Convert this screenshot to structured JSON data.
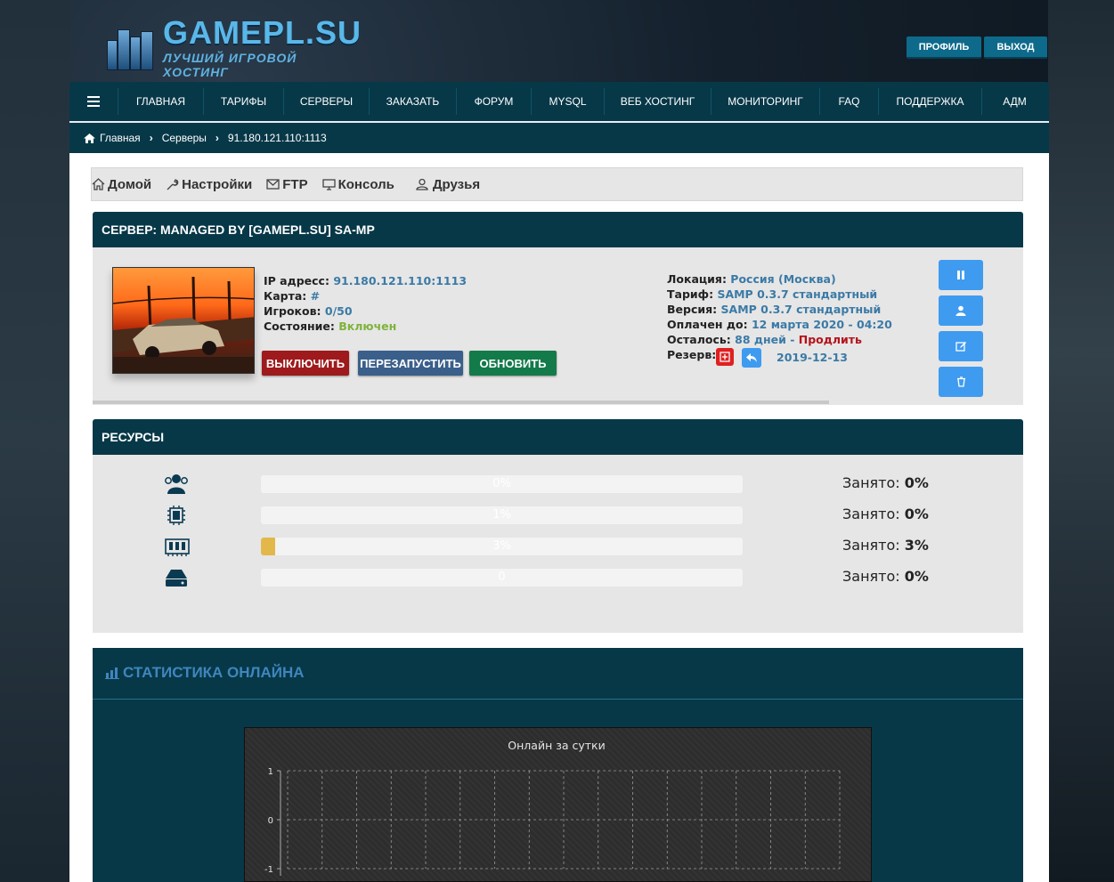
{
  "header": {
    "logo_title": "GAMEPL.SU",
    "logo_subtitle": "ЛУЧШИЙ ИГРОВОЙ ХОСТИНГ",
    "profile_button": "ПРОФИЛЬ",
    "logout_button": "ВЫХОД"
  },
  "nav": {
    "items": [
      "ГЛАВНАЯ",
      "ТАРИФЫ",
      "СЕРВЕРЫ",
      "ЗАКАЗАТЬ",
      "ФОРУМ",
      "MYSQL",
      "ВЕБ ХОСТИНГ",
      "МОНИТОРИНГ",
      "FAQ",
      "ПОДДЕРЖКА",
      "АДМ"
    ]
  },
  "breadcrumb": {
    "home": "Главная",
    "servers": "Серверы",
    "current": "91.180.121.110:1113"
  },
  "tabs": [
    "Домой",
    "Настройки",
    "FTP",
    "Консоль",
    "Друзья"
  ],
  "server": {
    "heading": "СЕРВЕР: MANAGED BY [GAMEPL.SU] SA-MP",
    "ip_label": "IP адресс:",
    "ip_value": "91.180.121.110:1113",
    "map_label": "Карта:",
    "map_value": "#",
    "players_label": "Игроков:",
    "players_value": "0/50",
    "state_label": "Состояние:",
    "state_value": "Включен",
    "btn_off": "ВЫКЛЮЧИТЬ",
    "btn_restart": "ПЕРЕЗАПУСТИТЬ",
    "btn_update": "ОБНОВИТЬ",
    "location_label": "Локация:",
    "location_value": "Россия (Москва)",
    "tariff_label": "Тариф:",
    "tariff_value": "SAMP 0.3.7 стандартный",
    "version_label": "Версия:",
    "version_value": "SAMP 0.3.7 стандартный",
    "paid_label": "Оплачен до:",
    "paid_value": "12 марта 2020 - 04:20",
    "left_label": "Осталось:",
    "left_value": "88 дней -",
    "extend_link": "Продлить",
    "backup_label": "Резерв:",
    "backup_date": "2019-12-13"
  },
  "resources": {
    "heading": "РЕСУРСЫ",
    "rows": [
      {
        "icon": "users-icon",
        "bar_text": "0%",
        "fill_percent": 0,
        "label": "Занято:",
        "value": "0%"
      },
      {
        "icon": "cpu-icon",
        "bar_text": "1%",
        "fill_percent": 0,
        "label": "Занято:",
        "value": "0%"
      },
      {
        "icon": "memory-icon",
        "bar_text": "3%",
        "fill_percent": 3,
        "label": "Занято:",
        "value": "3%"
      },
      {
        "icon": "disk-icon",
        "bar_text": "0",
        "fill_percent": 0,
        "label": "Занято:",
        "value": "0%"
      }
    ]
  },
  "stats": {
    "heading": "СТАТИСТИКА ОНЛАЙНА"
  },
  "chart_data": {
    "type": "line",
    "title": "Онлайн за сутки",
    "y_ticks": [
      "1",
      "0",
      "-1"
    ],
    "ylim": [
      -1,
      1
    ],
    "grid": true,
    "series": []
  },
  "colors": {
    "nav_bg": "#073848",
    "accent_blue": "#3f9bf0",
    "btn_red": "#9e1a1c",
    "btn_blue": "#3a5f8a",
    "btn_green": "#137a4a"
  }
}
